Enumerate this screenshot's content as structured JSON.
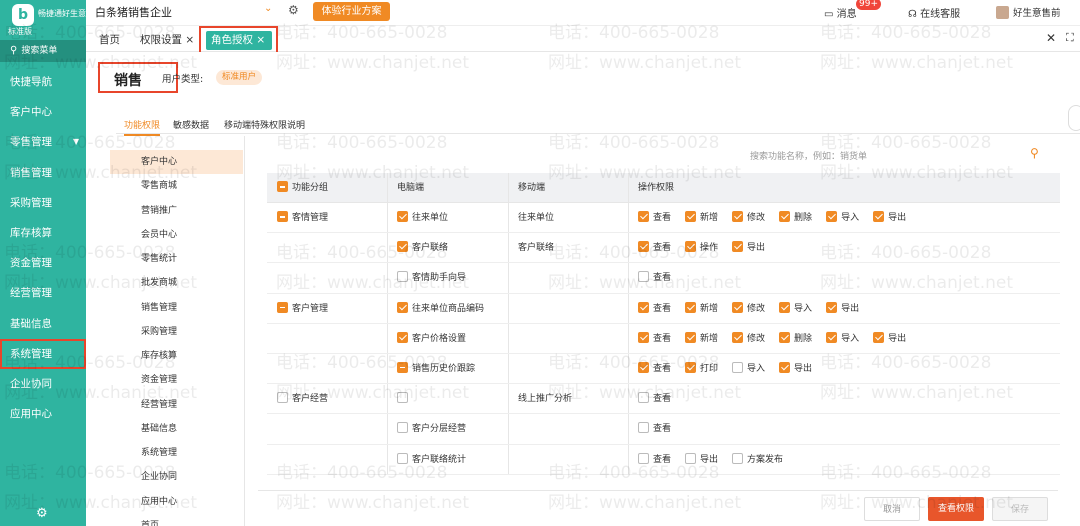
{
  "sidebar": {
    "logo_mark": "b",
    "logo_name": "畅捷通好生意",
    "logo_edition": "标准版",
    "search_label": "搜索菜单",
    "items": [
      {
        "label": "快捷导航",
        "caret": ""
      },
      {
        "label": "客户中心",
        "caret": ""
      },
      {
        "label": "零售管理",
        "caret": "▼"
      },
      {
        "label": "销售管理",
        "caret": ""
      },
      {
        "label": "采购管理",
        "caret": ""
      },
      {
        "label": "库存核算",
        "caret": ""
      },
      {
        "label": "资金管理",
        "caret": ""
      },
      {
        "label": "经营管理",
        "caret": ""
      },
      {
        "label": "基础信息",
        "caret": ""
      },
      {
        "label": "系统管理",
        "caret": ""
      },
      {
        "label": "企业协同",
        "caret": ""
      },
      {
        "label": "应用中心",
        "caret": ""
      }
    ],
    "selected_index": 9,
    "bottom_icon": "gear-icon"
  },
  "topbar": {
    "company": "白条猪销售企业",
    "trial_button": "体验行业方案",
    "messages_label": "消息",
    "messages_badge": "99+",
    "service_label": "在线客服",
    "user_label": "好生意售前"
  },
  "tabs": {
    "home": "首页",
    "permission_settings": "权限设置",
    "role_auth": "角色授权"
  },
  "role": {
    "name": "销售",
    "user_type_label": "用户类型:",
    "user_type_value": "标准用户"
  },
  "subtabs": [
    "功能权限",
    "敏感数据",
    "移动端特殊权限说明"
  ],
  "function_list": [
    "客户中心",
    "零售商城",
    "营销推广",
    "会员中心",
    "零售统计",
    "批发商城",
    "销售管理",
    "采购管理",
    "库存核算",
    "资金管理",
    "经营管理",
    "基础信息",
    "系统管理",
    "企业协同",
    "应用中心",
    "首页"
  ],
  "search_placeholder": "搜索功能名称，例如：销货单",
  "grid": {
    "headers": [
      "功能分组",
      "电脑端",
      "移动端",
      "操作权限"
    ],
    "rows": [
      {
        "group": "客情管理",
        "group_state": "minus",
        "pc": "往来单位",
        "pc_state": "on",
        "mobile": "往来单位",
        "perms": [
          [
            "查看",
            "on"
          ],
          [
            "新增",
            "on"
          ],
          [
            "修改",
            "on"
          ],
          [
            "删除",
            "on"
          ],
          [
            "导入",
            "on"
          ],
          [
            "导出",
            "on"
          ]
        ]
      },
      {
        "group": "",
        "group_state": "",
        "pc": "客户联络",
        "pc_state": "on",
        "mobile": "客户联络",
        "perms": [
          [
            "查看",
            "on"
          ],
          [
            "操作",
            "on"
          ],
          [
            "导出",
            "on"
          ]
        ]
      },
      {
        "group": "",
        "group_state": "",
        "pc": "客情助手向导",
        "pc_state": "off",
        "mobile": "",
        "perms": [
          [
            "查看",
            "off"
          ]
        ]
      },
      {
        "group": "客户管理",
        "group_state": "minus",
        "pc": "往来单位商品编码",
        "pc_state": "on",
        "mobile": "",
        "perms": [
          [
            "查看",
            "on"
          ],
          [
            "新增",
            "on"
          ],
          [
            "修改",
            "on"
          ],
          [
            "导入",
            "on"
          ],
          [
            "导出",
            "on"
          ]
        ]
      },
      {
        "group": "",
        "group_state": "",
        "pc": "客户价格设置",
        "pc_state": "on",
        "mobile": "",
        "perms": [
          [
            "查看",
            "on"
          ],
          [
            "新增",
            "on"
          ],
          [
            "修改",
            "on"
          ],
          [
            "删除",
            "on"
          ],
          [
            "导入",
            "on"
          ],
          [
            "导出",
            "on"
          ]
        ]
      },
      {
        "group": "",
        "group_state": "",
        "pc": "销售历史价跟踪",
        "pc_state": "minus",
        "mobile": "",
        "perms": [
          [
            "查看",
            "on"
          ],
          [
            "打印",
            "on"
          ],
          [
            "导入",
            "off"
          ],
          [
            "导出",
            "on"
          ]
        ]
      },
      {
        "group": "客户经营",
        "group_state": "off",
        "pc": "",
        "pc_state": "off",
        "mobile": "线上推广分析",
        "perms": [
          [
            "查看",
            "off"
          ]
        ]
      },
      {
        "group": "",
        "group_state": "",
        "pc": "客户分层经营",
        "pc_state": "off",
        "mobile": "",
        "perms": [
          [
            "查看",
            "off"
          ]
        ]
      },
      {
        "group": "",
        "group_state": "",
        "pc": "客户联络统计",
        "pc_state": "off",
        "mobile": "",
        "perms": [
          [
            "查看",
            "off"
          ],
          [
            "导出",
            "off"
          ],
          [
            "方案发布",
            "off"
          ]
        ]
      }
    ]
  },
  "footer": {
    "cancel": "取消",
    "view": "查看权限",
    "save": "保存"
  },
  "watermark": {
    "phone": "电话：400-665-0028",
    "site": "网址：www.chanjet.net"
  }
}
